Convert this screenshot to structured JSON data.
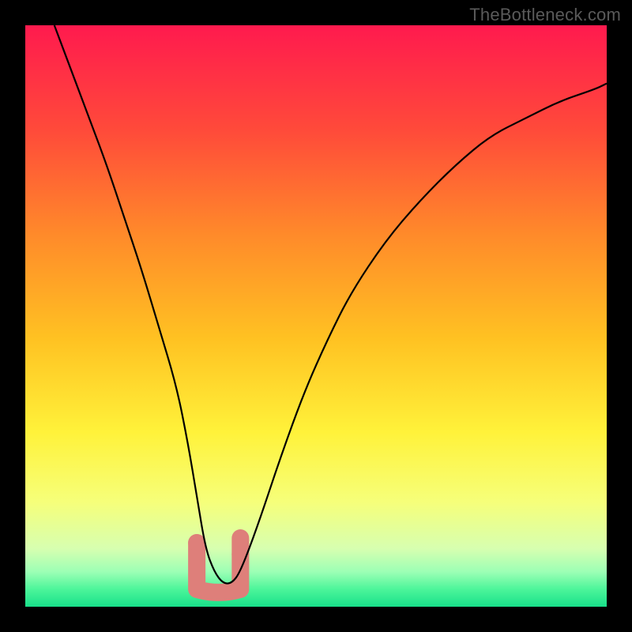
{
  "watermark": "TheBottleneck.com",
  "chart_data": {
    "type": "line",
    "title": "",
    "xlabel": "",
    "ylabel": "",
    "xlim": [
      0,
      100
    ],
    "ylim": [
      0,
      100
    ],
    "series": [
      {
        "name": "bottleneck-curve",
        "x": [
          5,
          8,
          11,
          14,
          17,
          20,
          23,
          26,
          28,
          29.5,
          31,
          32.5,
          34,
          35.5,
          37,
          40,
          44,
          48,
          52,
          56,
          62,
          68,
          74,
          80,
          86,
          92,
          98,
          100
        ],
        "y": [
          100,
          92,
          84,
          76,
          67,
          58,
          48,
          38,
          28,
          19,
          10,
          6,
          4,
          4,
          6,
          14,
          26,
          37,
          46,
          54,
          63,
          70,
          76,
          81,
          84,
          87,
          89,
          90
        ]
      }
    ],
    "highlight_region": {
      "x_start": 29.5,
      "x_end": 37,
      "y_min": 3,
      "y_max": 11,
      "color": "#de7f7a"
    },
    "background_gradient": {
      "stops": [
        {
          "offset": 0.0,
          "color": "#ff1a4e"
        },
        {
          "offset": 0.18,
          "color": "#ff4a3a"
        },
        {
          "offset": 0.36,
          "color": "#ff8a2a"
        },
        {
          "offset": 0.54,
          "color": "#ffc222"
        },
        {
          "offset": 0.7,
          "color": "#fff23a"
        },
        {
          "offset": 0.82,
          "color": "#f6ff7a"
        },
        {
          "offset": 0.9,
          "color": "#d7ffb0"
        },
        {
          "offset": 0.94,
          "color": "#9cffb5"
        },
        {
          "offset": 0.97,
          "color": "#4cf59a"
        },
        {
          "offset": 1.0,
          "color": "#18e08a"
        }
      ]
    }
  }
}
